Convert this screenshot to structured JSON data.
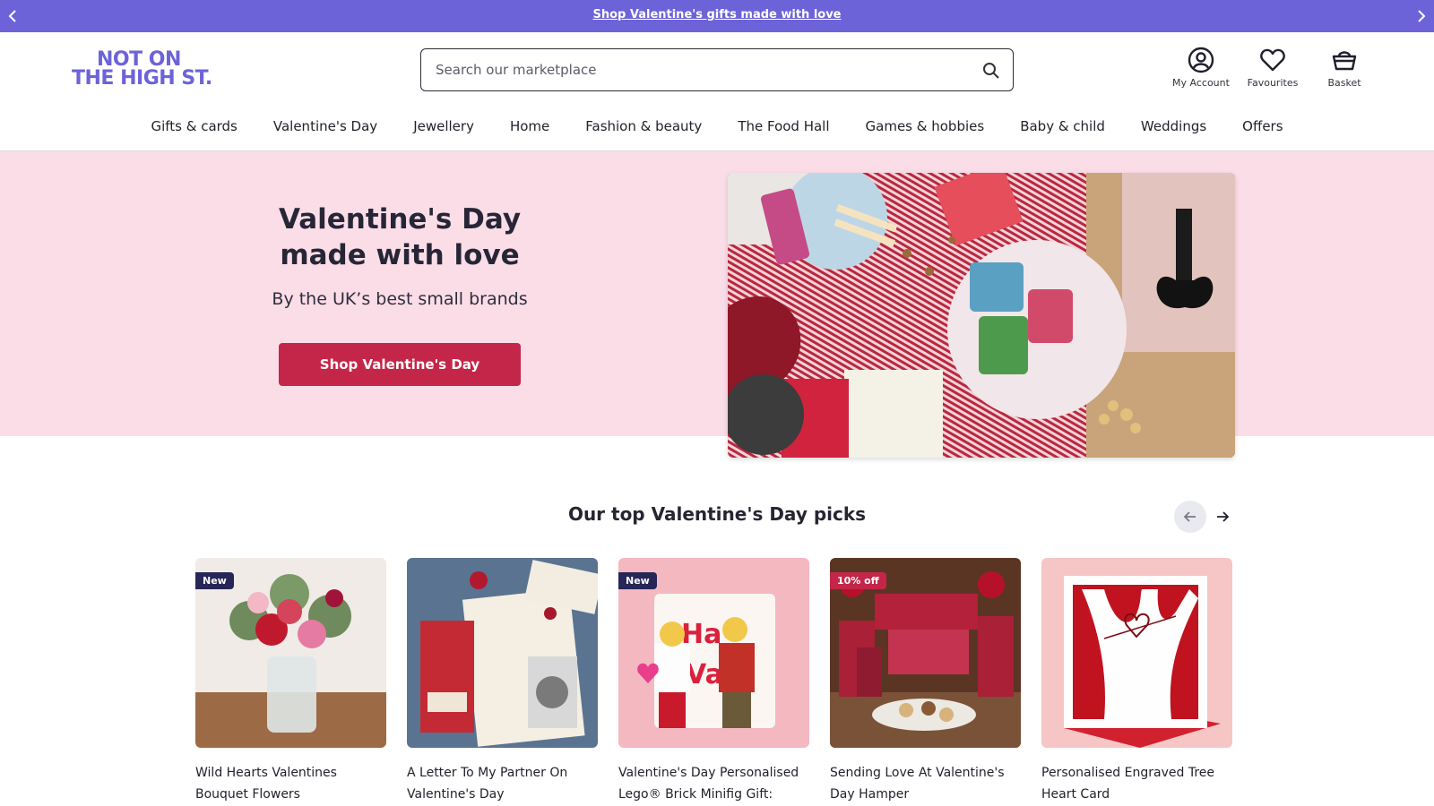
{
  "announcement": {
    "text": "Shop Valentine's gifts made with love"
  },
  "brand": {
    "logo_line1": "NOT ON",
    "logo_line2": "THE HIGH ST.",
    "accent": "#6c63d8"
  },
  "search": {
    "placeholder": "Search our marketplace"
  },
  "header_actions": [
    {
      "label": "My Account",
      "icon": "account-icon"
    },
    {
      "label": "Favourites",
      "icon": "heart-icon"
    },
    {
      "label": "Basket",
      "icon": "basket-icon"
    }
  ],
  "nav": [
    "Gifts & cards",
    "Valentine's Day",
    "Jewellery",
    "Home",
    "Fashion & beauty",
    "The Food Hall",
    "Games & hobbies",
    "Baby & child",
    "Weddings",
    "Offers"
  ],
  "hero": {
    "title_line1": "Valentine's Day",
    "title_line2": "made with love",
    "subtitle": "By the UK’s best small brands",
    "cta": "Shop Valentine's Day",
    "cta_color": "#c42649",
    "background": "#fbdde8"
  },
  "picks": {
    "title": "Our top Valentine's Day picks",
    "products": [
      {
        "badge": "New",
        "title": "Wild Hearts Valentines Bouquet Flowers"
      },
      {
        "badge": "",
        "title": "A Letter To My Partner On Valentine's Day"
      },
      {
        "badge": "New",
        "title": "Valentine's Day Personalised Lego® Brick Minifig Gift:"
      },
      {
        "badge": "10% off",
        "title": "Sending Love At Valentine's Day Hamper"
      },
      {
        "badge": "",
        "title": "Personalised Engraved Tree Heart Card"
      }
    ]
  }
}
